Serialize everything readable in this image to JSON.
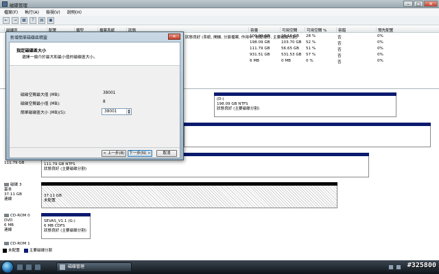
{
  "window": {
    "title": "磁碟管理",
    "buttons": {
      "min": "–",
      "max": "□",
      "close": "✕"
    }
  },
  "menu": [
    "檔案(F)",
    "執行(A)",
    "檢視(V)",
    "說明(H)"
  ],
  "toolbar": [
    "←",
    "→",
    "▦",
    "?",
    "▤",
    "▣"
  ],
  "volume_list": {
    "columns": [
      "磁碟區",
      "配置",
      "類型",
      "檔案系統",
      "狀態",
      "容量",
      "可用空間",
      "可用空間 %",
      "容錯",
      "預先配置"
    ],
    "rows": [
      {
        "status": "狀態良好 (系統, 開機, 分頁檔案, 作用中, 損毀傾印, 主要磁碟分割)",
        "capacity": "100.00 GB",
        "free": "28.16 GB",
        "pct": "28 %",
        "fault": "否",
        "overhead": "0%"
      },
      {
        "status": "",
        "capacity": "198.09 GB",
        "free": "103.70 GB",
        "pct": "52 %",
        "fault": "否",
        "overhead": "0%"
      },
      {
        "status": "",
        "capacity": "111.79 GB",
        "free": "56.65 GB",
        "pct": "51 %",
        "fault": "否",
        "overhead": "0%"
      },
      {
        "status": "",
        "capacity": "931.51 GB",
        "free": "531.53 GB",
        "pct": "57 %",
        "fault": "否",
        "overhead": "0%"
      },
      {
        "status": "",
        "capacity": "6 MB",
        "free": "0 MB",
        "pct": "0 %",
        "fault": "否",
        "overhead": "0%"
      }
    ]
  },
  "disks": {
    "d0_part2": {
      "name": "(D:)",
      "size": "198.09 GB NTFS",
      "status": "狀態良好 (主要磁碟分割)"
    },
    "disk2": {
      "size": "111.79 GB",
      "part_name": "(E:)",
      "part_size": "111.79 GB NTFS",
      "part_status": "狀態良好 (主要磁碟分割)"
    },
    "disk3": {
      "name": "磁碟 3",
      "type": "基本",
      "size": "37.11 GB",
      "state": "連線",
      "part_size": "37.11 GB",
      "part_status": "未配置"
    },
    "cdrom0": {
      "name": "CD-ROM 0",
      "type": "DVD",
      "size": "6 MB",
      "state": "連線",
      "part_name": "SEVAS_V1.1  (G:)",
      "part_size": "6 MB CDFS",
      "part_status": "狀態良好 (主要磁碟分割)"
    },
    "cdrom1": {
      "name": "CD-ROM 1"
    }
  },
  "legend": [
    "未配置",
    "主要磁碟分割"
  ],
  "dialog": {
    "title": "新增簡單磁碟區精靈",
    "heading": "指定磁碟區大小",
    "subheading": "選擇一個介於最大和最小值的磁碟區大小。",
    "max_label": "磁碟空間最大值 (MB):",
    "max_value": "38001",
    "min_label": "磁碟空間最小值 (MB):",
    "min_value": "8",
    "size_label": "簡單磁碟區大小 (MB)(S):",
    "size_value": "38001",
    "back": "< 上一步(B)",
    "next": "下一步(N) >",
    "cancel": "取消"
  },
  "taskbar": {
    "task_label": "磁碟管理",
    "watermark": "#325800"
  }
}
